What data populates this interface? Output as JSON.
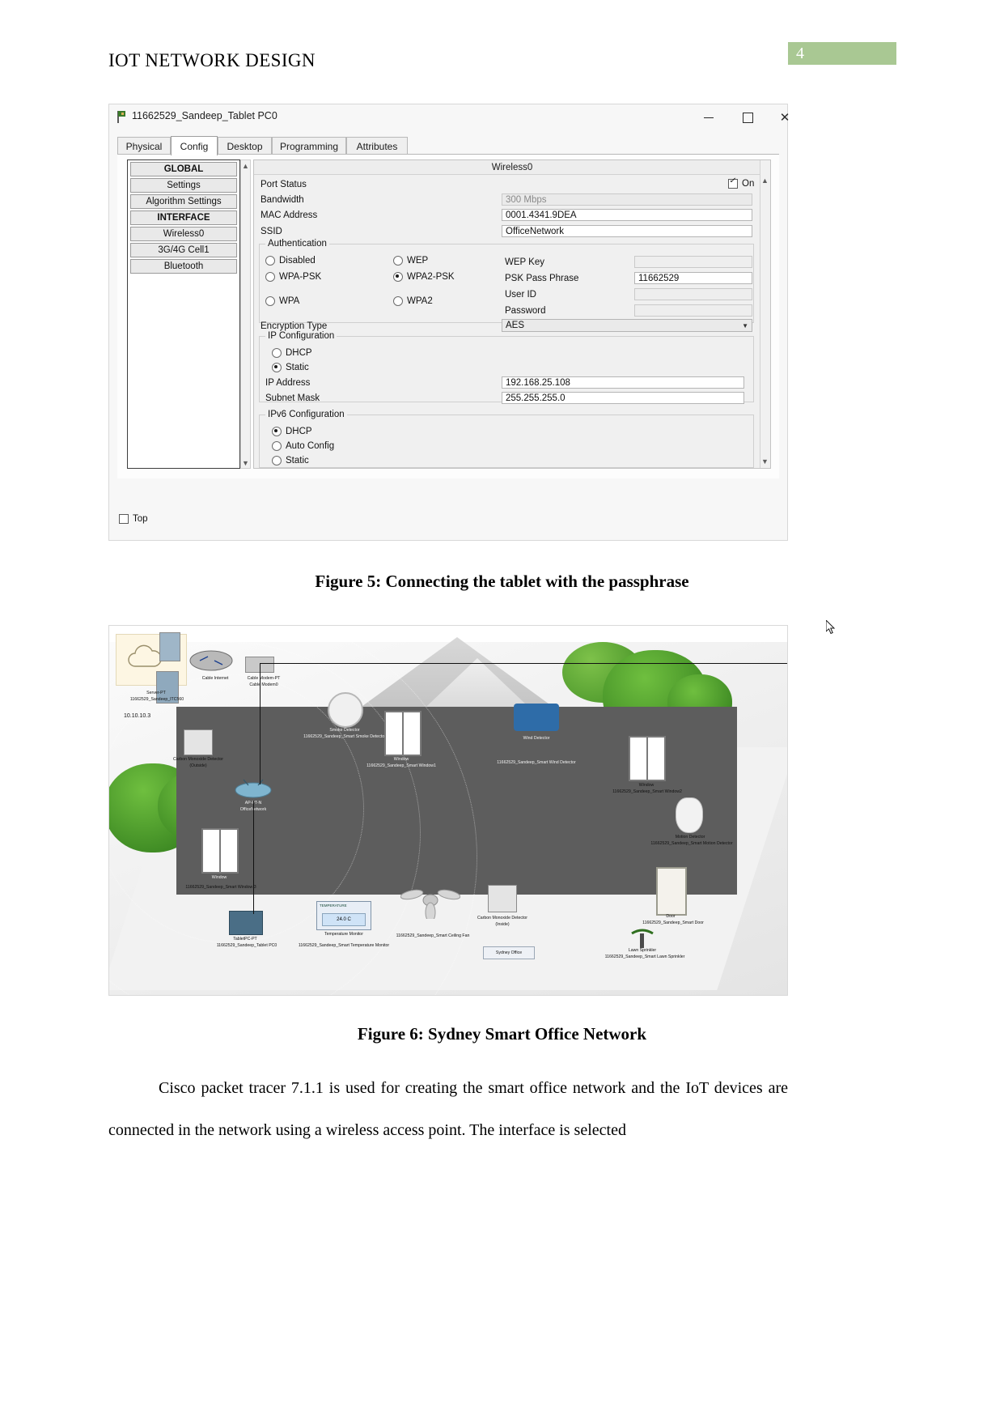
{
  "document": {
    "header_title": "IOT NETWORK DESIGN",
    "page_number": "4"
  },
  "packet_tracer_window": {
    "title": "11662529_Sandeep_Tablet PC0",
    "icon": "packet-tracer-flag-icon",
    "window_controls": {
      "minimize": "–",
      "maximize": "□",
      "close": "✕"
    },
    "tabs": [
      {
        "label": "Physical",
        "active": false
      },
      {
        "label": "Config",
        "active": true
      },
      {
        "label": "Desktop",
        "active": false
      },
      {
        "label": "Programming",
        "active": false
      },
      {
        "label": "Attributes",
        "active": false
      }
    ],
    "sidebar": [
      {
        "label": "GLOBAL",
        "type": "header"
      },
      {
        "label": "Settings",
        "type": "item"
      },
      {
        "label": "Algorithm Settings",
        "type": "item"
      },
      {
        "label": "INTERFACE",
        "type": "header"
      },
      {
        "label": "Wireless0",
        "type": "item"
      },
      {
        "label": "3G/4G Cell1",
        "type": "item"
      },
      {
        "label": "Bluetooth",
        "type": "item"
      }
    ],
    "panel": {
      "title": "Wireless0",
      "port_status": {
        "label": "Port Status",
        "checkbox_label": "On",
        "checked": true
      },
      "bandwidth": {
        "label": "Bandwidth",
        "value": "300 Mbps",
        "disabled": true
      },
      "mac_address": {
        "label": "MAC Address",
        "value": "0001.4341.9DEA"
      },
      "ssid": {
        "label": "SSID",
        "value": "OfficeNetwork"
      },
      "authentication": {
        "group_label": "Authentication",
        "options": [
          {
            "label": "Disabled",
            "selected": false
          },
          {
            "label": "WEP",
            "selected": false
          },
          {
            "label": "WPA-PSK",
            "selected": false
          },
          {
            "label": "WPA2-PSK",
            "selected": true
          },
          {
            "label": "WPA",
            "selected": false
          },
          {
            "label": "WPA2",
            "selected": false
          }
        ],
        "fields": [
          {
            "label": "WEP Key",
            "value": "",
            "enabled": false
          },
          {
            "label": "PSK Pass Phrase",
            "value": "11662529",
            "enabled": true
          },
          {
            "label": "User ID",
            "value": "",
            "enabled": false
          },
          {
            "label": "Password",
            "value": "",
            "enabled": false
          }
        ]
      },
      "encryption_type": {
        "label": "Encryption Type",
        "value": "AES"
      },
      "ip_configuration": {
        "group_label": "IP Configuration",
        "options": [
          {
            "label": "DHCP",
            "selected": false
          },
          {
            "label": "Static",
            "selected": true
          }
        ],
        "ip_address": {
          "label": "IP Address",
          "value": "192.168.25.108"
        },
        "subnet_mask": {
          "label": "Subnet Mask",
          "value": "255.255.255.0"
        }
      },
      "ipv6_configuration": {
        "group_label": "IPv6 Configuration",
        "options": [
          {
            "label": "DHCP",
            "selected": true
          },
          {
            "label": "Auto Config",
            "selected": false
          },
          {
            "label": "Static",
            "selected": false
          }
        ]
      }
    },
    "footer": {
      "top_checkbox_label": "Top",
      "top_checked": false
    }
  },
  "figures": [
    {
      "caption": "Figure 5: Connecting the tablet with the passphrase"
    },
    {
      "caption": "Figure 6: Sydney Smart Office Network",
      "labels": [
        {
          "name": "Server-PT",
          "id": "11662529_Sandeep_ITC560"
        },
        {
          "name": "Cable Internet",
          "id": ""
        },
        {
          "name": "Cable Modem-PT",
          "id": "Cable Modem0"
        },
        {
          "name": "10.10.10.3",
          "id": ""
        },
        {
          "name": "Carbon Monoxide Detector",
          "id": "(Outside)"
        },
        {
          "name": "Smoke Detector",
          "id": "11662529_Sandeep_Smart Smoke Detector"
        },
        {
          "name": "Window",
          "id": "11662529_Sandeep_Smart Window1"
        },
        {
          "name": "Wind Detector",
          "id": "11662529_Sandeep_Smart Wind Detector"
        },
        {
          "name": "Window",
          "id": "11662529_Sandeep_Smart Window2"
        },
        {
          "name": "Motion Detector",
          "id": "11662529_Sandeep_Smart Motion Detector"
        },
        {
          "name": "AP-PT-N",
          "id": "OfficeNetwork"
        },
        {
          "name": "Window",
          "id": "11662529_Sandeep_Smart Window 3"
        },
        {
          "name": "TabletPC-PT",
          "id": "11662529_Sandeep_Tablet PC0"
        },
        {
          "name": "Temperature Monitor",
          "id": "11662529_Sandeep_Smart Temperature Monitor"
        },
        {
          "name": "Fan",
          "id": "11662529_Sandeep_Smart Ceiling Fan"
        },
        {
          "name": "Carbon Monoxide Detector",
          "id": "(Inside)"
        },
        {
          "name": "Door",
          "id": "11662529_Sandeep_Smart Door"
        },
        {
          "name": "Lawn Sprinkler",
          "id": "11662529_Sandeep_Smart Lawn Sprinkler"
        },
        {
          "name": "Sydney Office",
          "id": ""
        },
        {
          "name": "TEMPERATURE",
          "id": "24.0 C"
        }
      ]
    }
  ],
  "body": {
    "paragraph": "Cisco packet tracer 7.1.1 is used for creating the smart office network and the IoT devices are connected in the network using a wireless access point. The interface is selected"
  },
  "colors": {
    "page_number_badge": "#a9c893",
    "room_floor": "#5d5d5d",
    "foliage": "#3f8c23",
    "window_frame": "#7a7a7a"
  }
}
